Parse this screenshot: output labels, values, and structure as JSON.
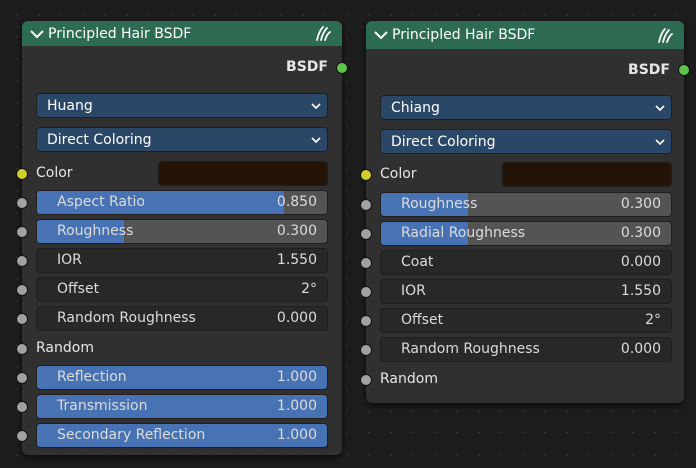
{
  "colors": {
    "header": "#2d6b52",
    "node_bg": "#303030",
    "dropdown": "#2b4768",
    "slider_fill": "#4772b3",
    "slider_bg": "#545454",
    "socket_bsdf": "#5ec44a",
    "socket_color": "#cfcf2a",
    "socket_value": "#a1a1a1",
    "color_swatch": "#241408"
  },
  "nodes": [
    {
      "title": "Principled Hair BSDF",
      "output": "BSDF",
      "model": "Huang",
      "parametrization": "Direct Coloring",
      "color_label": "Color",
      "fields": [
        {
          "label": "Aspect Ratio",
          "value": "0.850",
          "fill": 0.85
        },
        {
          "label": "Roughness",
          "value": "0.300",
          "fill": 0.3
        },
        {
          "label": "IOR",
          "value": "1.550",
          "fill": 0
        },
        {
          "label": "Offset",
          "value": "2°",
          "fill": 0
        },
        {
          "label": "Random Roughness",
          "value": "0.000",
          "fill": 0
        }
      ],
      "random_label": "Random",
      "factors": [
        {
          "label": "Reflection",
          "value": "1.000",
          "fill": 1
        },
        {
          "label": "Transmission",
          "value": "1.000",
          "fill": 1
        },
        {
          "label": "Secondary Reflection",
          "value": "1.000",
          "fill": 1
        }
      ]
    },
    {
      "title": "Principled Hair BSDF",
      "output": "BSDF",
      "model": "Chiang",
      "parametrization": "Direct Coloring",
      "color_label": "Color",
      "fields": [
        {
          "label": "Roughness",
          "value": "0.300",
          "fill": 0.3
        },
        {
          "label": "Radial Roughness",
          "value": "0.300",
          "fill": 0.3
        },
        {
          "label": "Coat",
          "value": "0.000",
          "fill": 0
        },
        {
          "label": "IOR",
          "value": "1.550",
          "fill": 0
        },
        {
          "label": "Offset",
          "value": "2°",
          "fill": 0
        },
        {
          "label": "Random Roughness",
          "value": "0.000",
          "fill": 0
        }
      ],
      "random_label": "Random"
    }
  ]
}
